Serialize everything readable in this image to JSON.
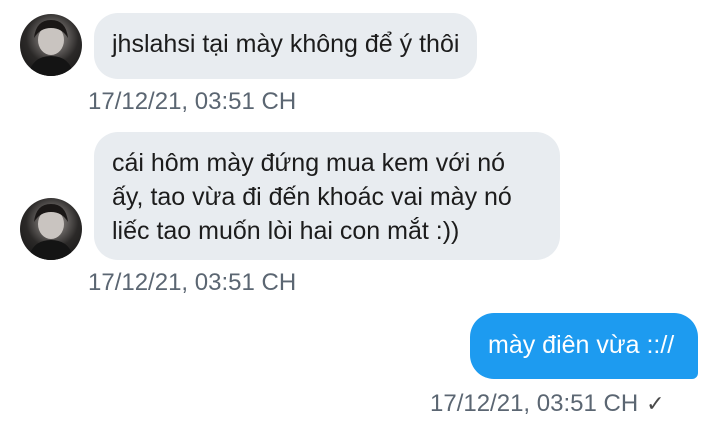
{
  "messages": [
    {
      "direction": "incoming",
      "text": "jhslahsi tại mày không để ý thôi",
      "timestamp": "17/12/21, 03:51 CH"
    },
    {
      "direction": "incoming",
      "text": "cái hôm mày đứng mua kem với nó\nấy, tao vừa đi đến khoác vai mày nó\nliếc tao muốn lòi hai con mắt :))",
      "timestamp": "17/12/21, 03:51 CH"
    },
    {
      "direction": "outgoing",
      "text": "mày điên vừa :://",
      "timestamp": "17/12/21, 03:51 CH",
      "status_icon": "check-icon",
      "status_glyph": "✓"
    }
  ],
  "colors": {
    "incoming_bubble": "#e8ecf0",
    "outgoing_bubble": "#1d9bf0",
    "timestamp": "#5b6672"
  }
}
